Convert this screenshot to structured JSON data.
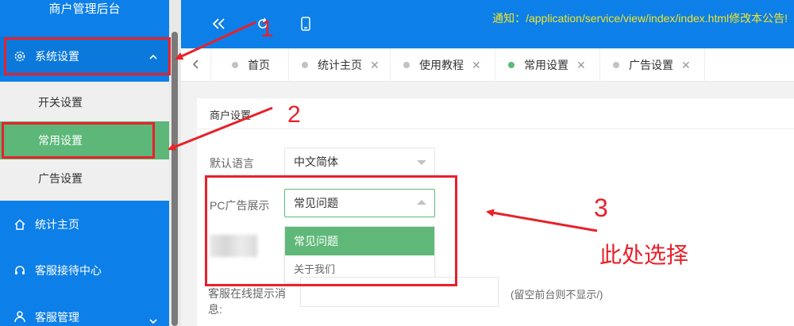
{
  "sidebar": {
    "brand": "商户管理后台",
    "system_settings": "系统设置",
    "submenu": [
      "开关设置",
      "常用设置",
      "广告设置"
    ],
    "stats_home": "统计主页",
    "cs_center": "客服接待中心",
    "cs_manage": "客服管理"
  },
  "topbar": {
    "notice": "通知：/application/service/view/index/index.html修改本公告!"
  },
  "tabs": [
    {
      "label": "首页"
    },
    {
      "label": "统计主页"
    },
    {
      "label": "使用教程"
    },
    {
      "label": "常用设置"
    },
    {
      "label": "广告设置"
    }
  ],
  "form": {
    "section_title": "商户设置",
    "language_label": "默认语言",
    "language_value": "中文简体",
    "pc_ad_label": "PC广告展示",
    "pc_ad_value": "常见问题",
    "pc_ad_options": [
      "常见问题",
      "关于我们"
    ],
    "cs_label": "客服在线提示消息:",
    "cs_hint": "(留空前台则不显示/)"
  },
  "annotations": {
    "step1": "1",
    "step2": "2",
    "step3": "3",
    "note": "此处选择"
  },
  "colors": {
    "primary": "#0d7fe8",
    "active_green": "#5cb778",
    "notice_yellow": "#f2e526",
    "annotation_red": "#e8212a"
  }
}
